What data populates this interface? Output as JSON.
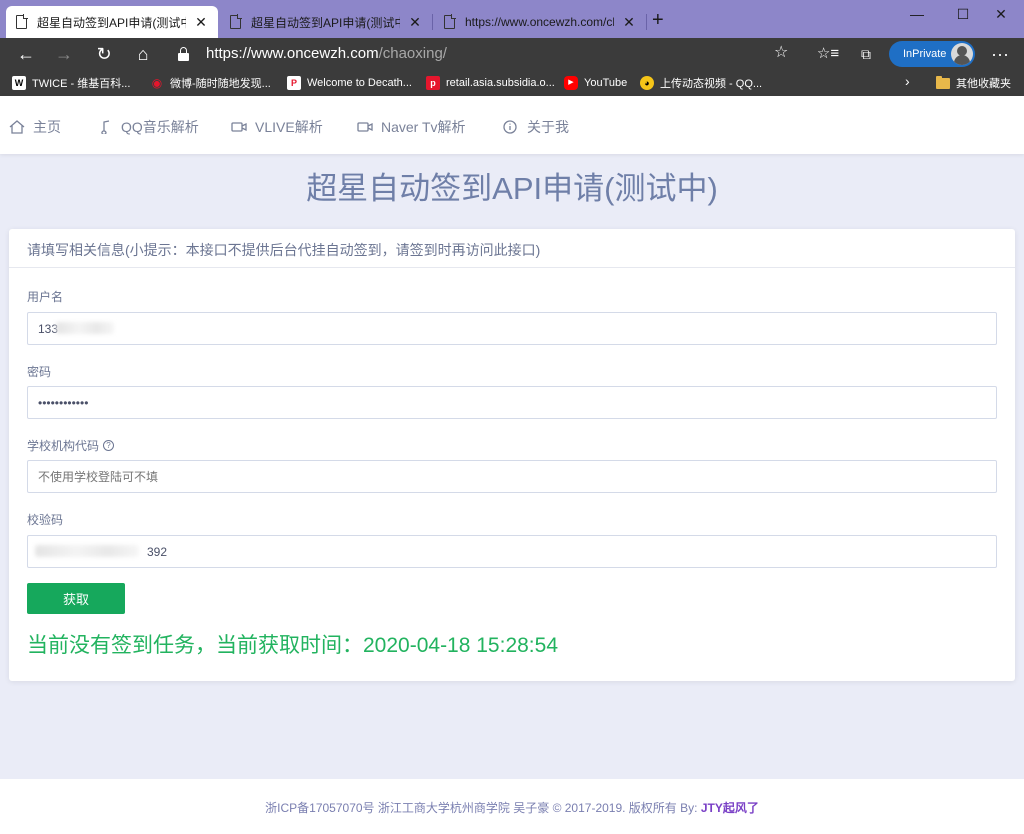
{
  "browser": {
    "tabs": [
      {
        "title": "超星自动签到API申请(测试中)",
        "active": true
      },
      {
        "title": "超星自动签到API申请(测试中)",
        "active": false
      },
      {
        "title": "https://www.oncewzh.com/chaoxing/",
        "active": false
      }
    ],
    "url_host": "https://www.oncewzh.com",
    "url_path": "/chaoxing/",
    "inprivate_label": "InPrivate",
    "bookmarks": [
      {
        "label": "TWICE - 维基百科...",
        "color": "#ffffff",
        "text_color": "#000000",
        "glyph": "W"
      },
      {
        "label": "微博-随时随地发现...",
        "color": "#e6162d",
        "text_color": "#ffffff",
        "glyph": "◉"
      },
      {
        "label": "Welcome to Decath...",
        "color": "#e6162d",
        "text_color": "#ffffff",
        "glyph": "P"
      },
      {
        "label": "retail.asia.subsidia.o...",
        "color": "#e6162d",
        "text_color": "#ffffff",
        "glyph": "p"
      },
      {
        "label": "YouTube",
        "color": "#ff0000",
        "text_color": "#ffffff",
        "glyph": "▶"
      },
      {
        "label": "上传动态视频 - QQ...",
        "color": "#f5c518",
        "text_color": "#000000",
        "glyph": "◕"
      }
    ],
    "other_bookmarks": "其他收藏夹"
  },
  "site_nav": {
    "items": [
      {
        "label": "主页",
        "icon": "home-icon"
      },
      {
        "label": "QQ音乐解析",
        "icon": "music-note-icon"
      },
      {
        "label": "VLIVE解析",
        "icon": "video-camera-icon"
      },
      {
        "label": "Naver Tv解析",
        "icon": "video-camera-icon"
      },
      {
        "label": "关于我",
        "icon": "info-icon"
      }
    ]
  },
  "page": {
    "title": "超星自动签到API申请(测试中)",
    "card_header": "请填写相关信息(小提示：本接口不提供后台代挂自动签到，请签到时再访问此接口)",
    "fields": {
      "username_label": "用户名",
      "username_value": "133",
      "password_label": "密码",
      "password_value": "••••••••••••",
      "school_label": "学校机构代码",
      "school_placeholder": "不使用学校登陆可不填",
      "captcha_label": "校验码",
      "captcha_value": "392"
    },
    "submit_label": "获取",
    "status": "当前没有签到任务，当前获取时间：2020-04-18 15:28:54"
  },
  "footer": {
    "icp": "浙ICP备17057070号",
    "school": "浙江工商大学杭州商学院 吴子豪",
    "copyright": "© 2017-2019. 版权所有 By:",
    "author": "JTY起风了"
  },
  "colors": {
    "title_bar": "#8d86c9",
    "chrome_dark": "#3b3b3b",
    "accent_green": "#16a85c",
    "status_green": "#22b35f",
    "page_bg": "#eaecf7"
  }
}
